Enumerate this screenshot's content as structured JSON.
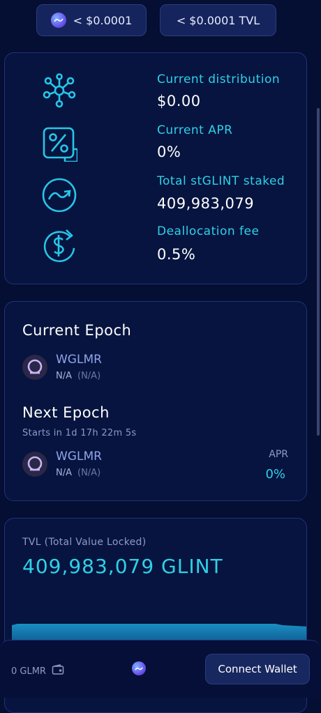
{
  "header": {
    "price_pill": "< $0.0001",
    "tvl_pill": "< $0.0001 TVL"
  },
  "stats": [
    {
      "icon": "network-icon",
      "label": "Current distribution",
      "value": "$0.00"
    },
    {
      "icon": "percent-icon",
      "label": "Current APR",
      "value": "0%"
    },
    {
      "icon": "glint-icon",
      "label": "Total stGLINT staked",
      "value": "409,983,079"
    },
    {
      "icon": "dollar-refresh-icon",
      "label": "Deallocation fee",
      "value": "0.5%"
    }
  ],
  "current_epoch": {
    "title": "Current Epoch",
    "token": "WGLMR",
    "amount": "N/A",
    "amount_sub": "(N/A)"
  },
  "next_epoch": {
    "title": "Next Epoch",
    "starts_in": "Starts in 1d 17h 22m 5s",
    "token": "WGLMR",
    "amount": "N/A",
    "amount_sub": "(N/A)",
    "apr_label": "APR",
    "apr_value": "0%"
  },
  "tvl": {
    "label": "TVL (Total Value Locked)",
    "value": "409,983,079 GLINT"
  },
  "colors": {
    "accent": "#2ed1e8",
    "background": "#050e33",
    "card": "#07143f"
  },
  "bottom_bar": {
    "balance": "0 GLMR",
    "connect_label": "Connect Wallet"
  }
}
